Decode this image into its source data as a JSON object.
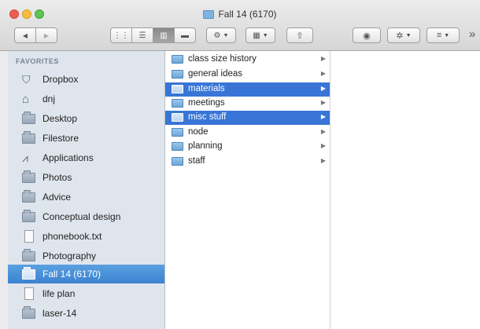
{
  "window": {
    "title": "Fall 14 (6170)"
  },
  "toolbar": {
    "back_glyph": "◀",
    "forward_glyph": "▶",
    "view_icon_glyph": "⋮⋮",
    "view_list_glyph": "☰",
    "view_column_glyph": "▥",
    "view_coverflow_glyph": "▬",
    "arrange_glyph": "⚙",
    "arrange2_glyph": "▦",
    "share_glyph": "⇧",
    "quicklook_glyph": "◉",
    "action_glyph": "✲",
    "path_glyph": "≡",
    "overflow_glyph": "»"
  },
  "sidebar": {
    "header": "FAVORITES",
    "items": [
      {
        "label": "Dropbox",
        "icon": "dropbox-icon"
      },
      {
        "label": "dnj",
        "icon": "home-icon"
      },
      {
        "label": "Desktop",
        "icon": "desktop-folder-icon"
      },
      {
        "label": "Filestore",
        "icon": "folder-icon"
      },
      {
        "label": "Applications",
        "icon": "applications-icon"
      },
      {
        "label": "Photos",
        "icon": "folder-icon"
      },
      {
        "label": "Advice",
        "icon": "folder-icon"
      },
      {
        "label": "Conceptual design",
        "icon": "folder-icon"
      },
      {
        "label": "phonebook.txt",
        "icon": "file-icon"
      },
      {
        "label": "Photography",
        "icon": "folder-icon"
      },
      {
        "label": "Fall 14 (6170)",
        "icon": "folder-icon",
        "selected": true
      },
      {
        "label": "life plan",
        "icon": "file-icon"
      },
      {
        "label": "laser-14",
        "icon": "folder-icon"
      }
    ]
  },
  "column1": {
    "items": [
      {
        "label": "class size history"
      },
      {
        "label": "general ideas"
      },
      {
        "label": "materials",
        "selected": true
      },
      {
        "label": "meetings"
      },
      {
        "label": "misc stuff",
        "selected": true
      },
      {
        "label": "node"
      },
      {
        "label": "planning"
      },
      {
        "label": "staff"
      }
    ]
  },
  "colors": {
    "sidebar_bg": "#dfe5ed",
    "selection": "#3875d7",
    "sidebar_selection": "#3b82d0"
  }
}
